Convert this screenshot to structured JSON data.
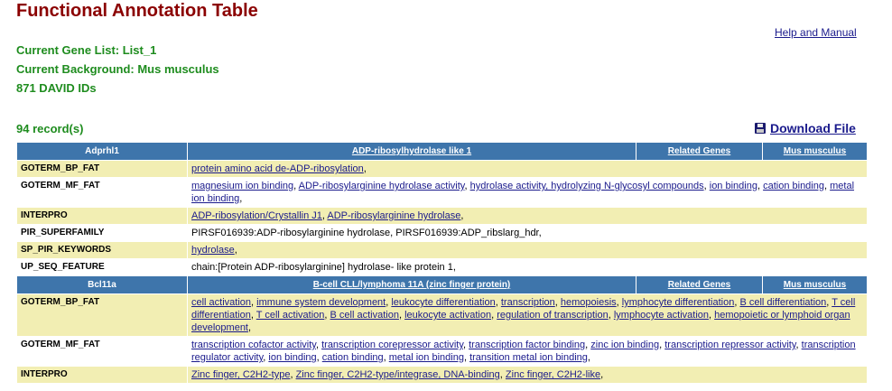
{
  "page": {
    "title": "Functional Annotation Table",
    "help_link": "Help and Manual",
    "gene_list": "Current Gene List: List_1",
    "background": "Current Background: Mus musculus",
    "id_count": "871 DAVID IDs",
    "records": "94 record(s)",
    "download_label": "Download File"
  },
  "columns": {
    "related": "Related Genes",
    "species": "Mus musculus"
  },
  "genes": [
    {
      "id": "Adprhl1",
      "name": "ADP-ribosylhydrolase like 1",
      "rows": [
        {
          "category": "GOTERM_BP_FAT",
          "linked": true,
          "terms": [
            "protein amino acid de-ADP-ribosylation"
          ]
        },
        {
          "category": "GOTERM_MF_FAT",
          "linked": true,
          "terms": [
            "magnesium ion binding",
            "ADP-ribosylarginine hydrolase activity",
            "hydrolase activity, hydrolyzing N-glycosyl compounds",
            "ion binding",
            "cation binding",
            "metal ion binding"
          ]
        },
        {
          "category": "INTERPRO",
          "linked": true,
          "terms": [
            "ADP-ribosylation/Crystallin J1",
            "ADP-ribosylarginine hydrolase"
          ]
        },
        {
          "category": "PIR_SUPERFAMILY",
          "linked": false,
          "terms": [
            "PIRSF016939:ADP-ribosylarginine hydrolase",
            "PIRSF016939:ADP_ribslarg_hdr"
          ]
        },
        {
          "category": "SP_PIR_KEYWORDS",
          "linked": true,
          "terms": [
            "hydrolase"
          ]
        },
        {
          "category": "UP_SEQ_FEATURE",
          "linked": false,
          "terms": [
            "chain:[Protein ADP-ribosylarginine] hydrolase- like protein 1"
          ]
        }
      ]
    },
    {
      "id": "Bcl11a",
      "name": "B-cell CLL/lymphoma 11A (zinc finger protein)",
      "rows": [
        {
          "category": "GOTERM_BP_FAT",
          "linked": true,
          "terms": [
            "cell activation",
            "immune system development",
            "leukocyte differentiation",
            "transcription",
            "hemopoiesis",
            "lymphocyte differentiation",
            "B cell differentiation",
            "T cell differentiation",
            "T cell activation",
            "B cell activation",
            "leukocyte activation",
            "regulation of transcription",
            "lymphocyte activation",
            "hemopoietic or lymphoid organ development"
          ]
        },
        {
          "category": "GOTERM_MF_FAT",
          "linked": true,
          "terms": [
            "transcription cofactor activity",
            "transcription corepressor activity",
            "transcription factor binding",
            "zinc ion binding",
            "transcription repressor activity",
            "transcription regulator activity",
            "ion binding",
            "cation binding",
            "metal ion binding",
            "transition metal ion binding"
          ]
        },
        {
          "category": "INTERPRO",
          "linked": true,
          "terms": [
            "Zinc finger, C2H2-type",
            "Zinc finger, C2H2-type/integrase, DNA-binding",
            "Zinc finger, C2H2-like"
          ]
        }
      ]
    }
  ]
}
